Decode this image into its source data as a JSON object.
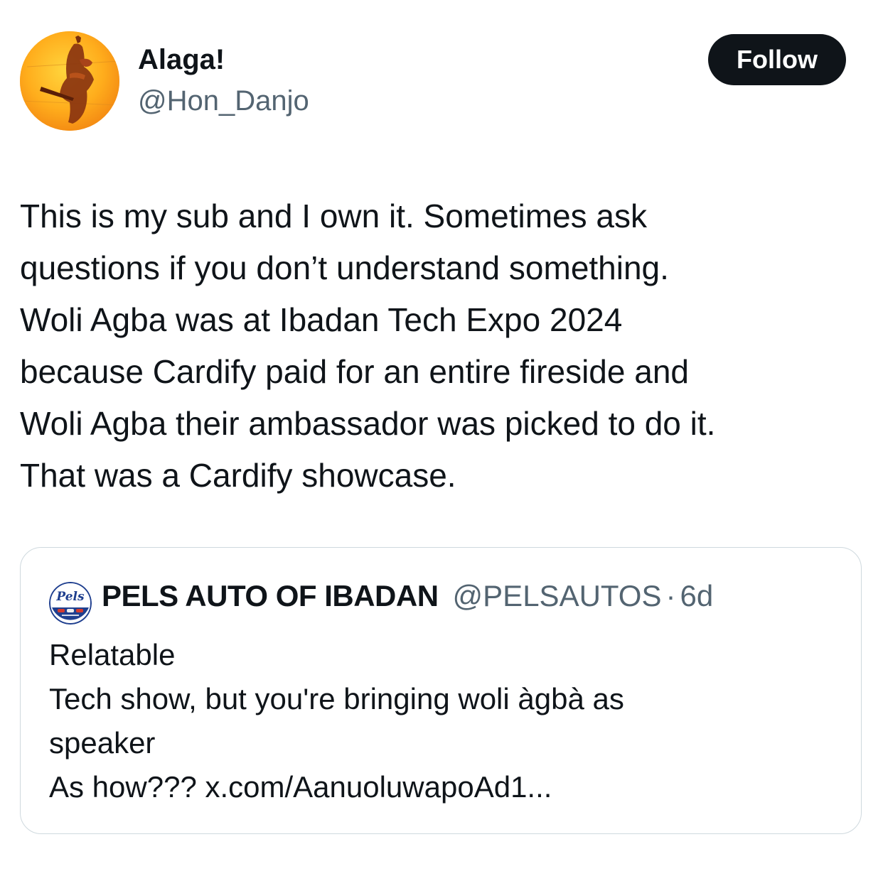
{
  "author": {
    "display_name": "Alaga!",
    "handle": "@Hon_Danjo",
    "avatar_icon": "profile-photo-figure"
  },
  "follow_button": {
    "label": "Follow"
  },
  "tweet": {
    "lines": [
      "This is my sub and I own it. Sometimes ask",
      "questions if you don’t understand something.",
      "Woli Agba was at Ibadan Tech Expo 2024",
      "because Cardify paid for an entire fireside and",
      "Woli Agba their ambassador was picked to do it.",
      "That was a Cardify showcase."
    ]
  },
  "quoted_tweet": {
    "display_name": "PELS AUTO OF IBADAN",
    "handle": "@PELSAUTOS",
    "separator": "·",
    "time": "6d",
    "avatar_text": "Pels",
    "lines": [
      "Relatable",
      "Tech show, but you're bringing woli àgbà as",
      "speaker",
      "As how??? x.com/AanuoluwapoAd1..."
    ]
  },
  "colors": {
    "text_primary": "#0f1419",
    "text_secondary": "#536471",
    "border": "#cfd9de",
    "follow_bg": "#0f1419",
    "avatar_orange": "#f7a21b"
  }
}
